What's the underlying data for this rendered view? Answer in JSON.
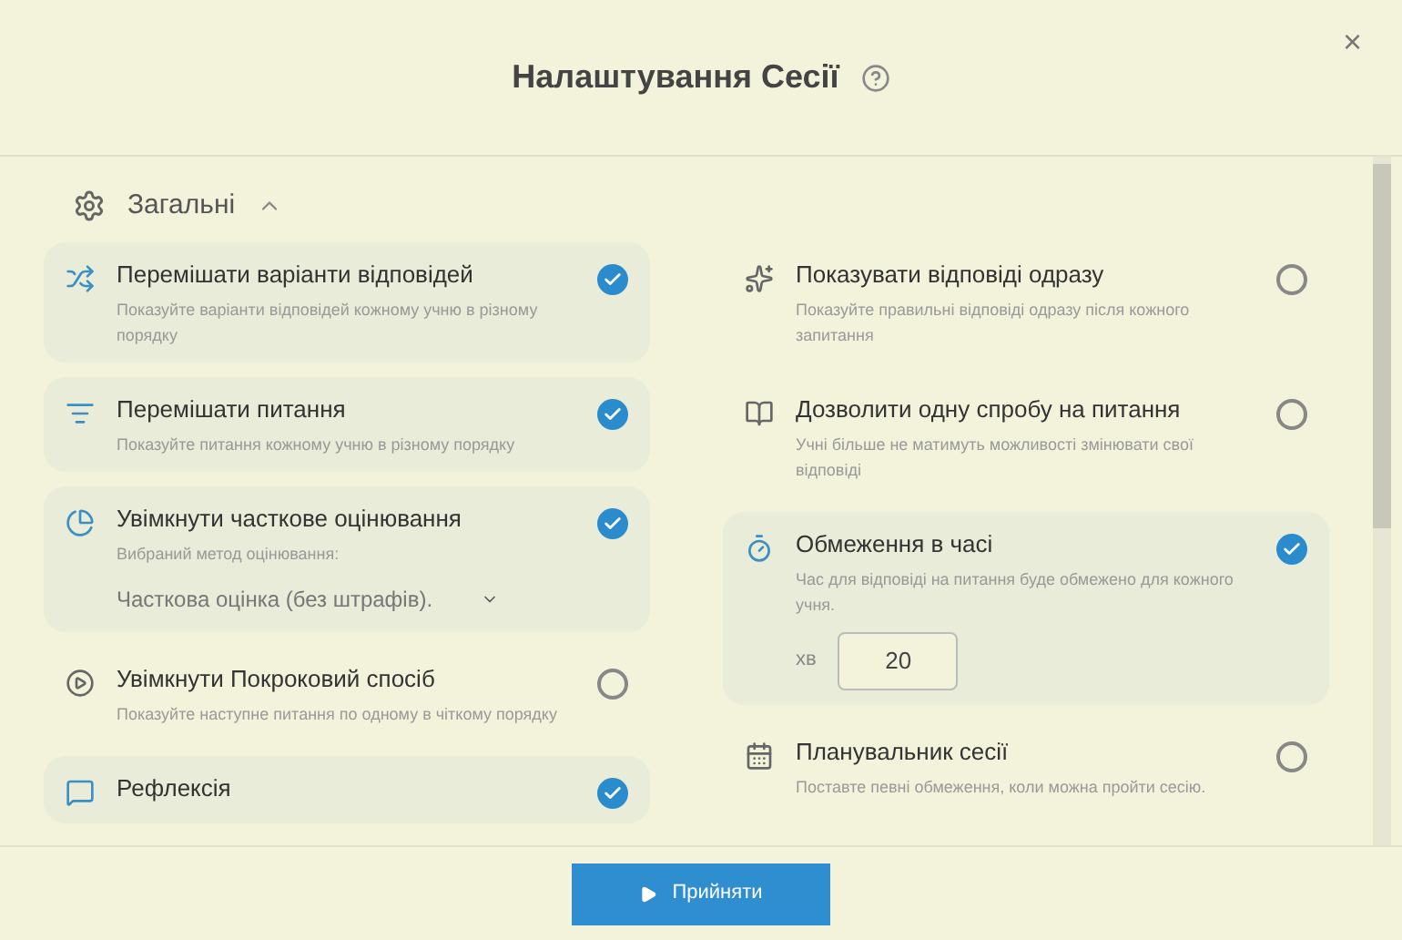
{
  "dialog": {
    "title": "Налаштування Сесії",
    "close": "×"
  },
  "section": {
    "title": "Загальні",
    "expanded": true
  },
  "left_column": [
    {
      "kind": "toggle",
      "title": "Перемішати варіанти відповідей",
      "description": "Показуйте варіанти відповідей кожному учню в різному порядку",
      "checked": true
    },
    {
      "kind": "toggle",
      "title": "Перемішати питання",
      "description": "Показуйте питання кожному учню в різному порядку",
      "checked": true
    },
    {
      "kind": "select",
      "title": "Увімкнути часткове оцінювання",
      "description": "Вибраний метод оцінювання:",
      "value": "Часткова оцінка (без штрафів).",
      "checked": true
    },
    {
      "kind": "toggle",
      "title": "Увімкнути Покроковий спосіб",
      "description": "Показуйте наступне питання по одному в чіткому порядку",
      "checked": false
    },
    {
      "kind": "toggle",
      "title": "Рефлексія",
      "checked": true
    }
  ],
  "right_column": [
    {
      "kind": "toggle",
      "title": "Показувати відповіді одразу",
      "description": "Показуйте правильні відповіді одразу після кожного запитання",
      "checked": false
    },
    {
      "kind": "toggle",
      "title": "Дозволити одну спробу на питання",
      "description": "Учні більше не матимуть можливості змінювати свої відповіді",
      "checked": false
    },
    {
      "kind": "timer",
      "title": "Обмеження в часі",
      "description": "Час для відповіді на питання буде обмежено для кожного учня.",
      "unit": "хв",
      "value": "20",
      "checked": true
    },
    {
      "kind": "toggle",
      "title": "Планувальник сесії",
      "description": "Поставте певні обмеження, коли можна пройти сесію.",
      "checked": false
    }
  ],
  "footer": {
    "button": "Прийняти"
  }
}
